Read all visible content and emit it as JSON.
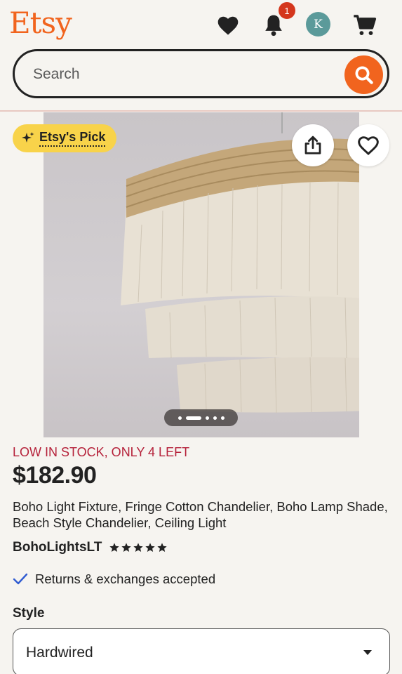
{
  "header": {
    "logo": "Etsy",
    "notification_count": "1",
    "avatar_initial": "K"
  },
  "search": {
    "placeholder": "Search"
  },
  "listing": {
    "badge": "Etsy's Pick",
    "stock_notice": "LOW IN STOCK, ONLY 4 LEFT",
    "price": "$182.90",
    "title": "Boho Light Fixture, Fringe Cotton Chandelier, Boho Lamp Shade, Beach Style Chandelier, Ceiling Light",
    "shop_name": "BohoLightsLT",
    "rating_stars": 5,
    "returns_text": "Returns & exchanges accepted",
    "image_count": 5,
    "active_image_index": 1
  },
  "options": {
    "style_label": "Style",
    "style_value": "Hardwired"
  },
  "colors": {
    "brand": "#f1641e",
    "badge": "#f8d34a",
    "stock": "#b5213a",
    "check": "#2f5bd1"
  }
}
